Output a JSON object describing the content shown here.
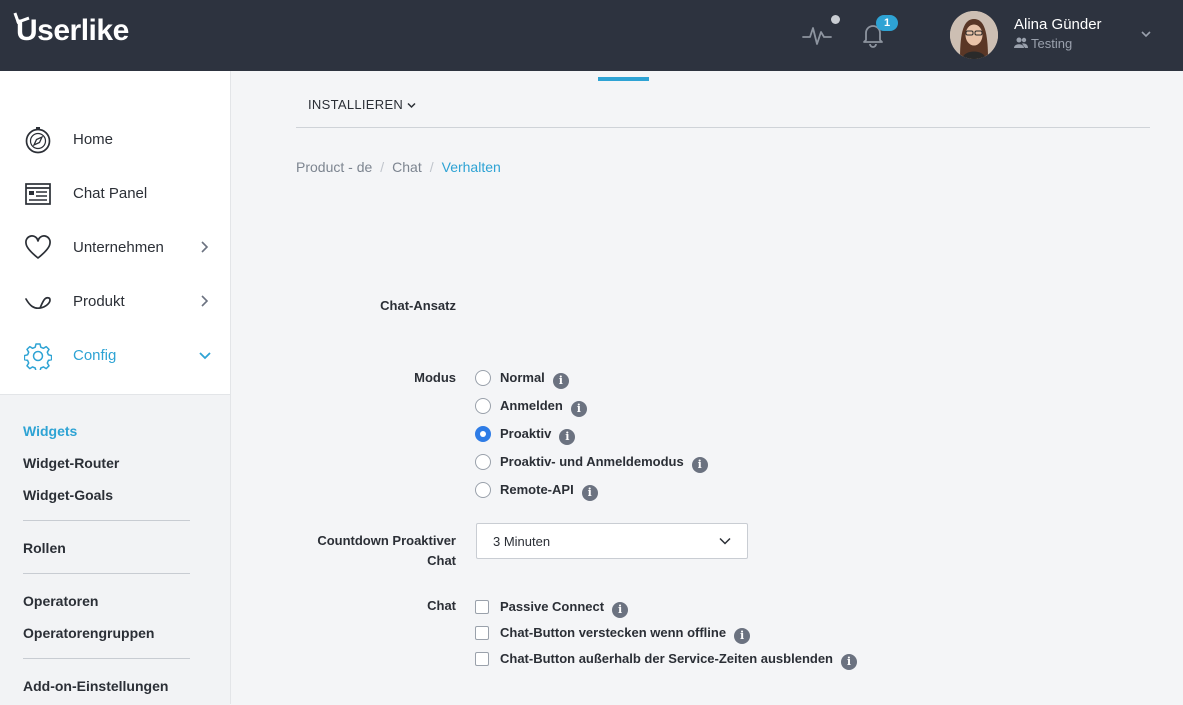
{
  "header": {
    "logo_text": "Userlike",
    "notification_count": "1",
    "user": {
      "name": "Alina Günder",
      "team": "Testing"
    }
  },
  "sidebar": {
    "items": [
      {
        "label": "Home",
        "icon": "compass-icon"
      },
      {
        "label": "Chat Panel",
        "icon": "chat-panel-icon"
      },
      {
        "label": "Unternehmen",
        "icon": "heart-icon"
      },
      {
        "label": "Produkt",
        "icon": "product-icon"
      },
      {
        "label": "Config",
        "icon": "gear-icon"
      }
    ],
    "sub_items": [
      "Widgets",
      "Widget-Router",
      "Widget-Goals",
      "Rollen",
      "Operatoren",
      "Operatorengruppen",
      "Add-on-Einstellungen"
    ]
  },
  "main": {
    "install_tab": "INSTALLIEREN",
    "breadcrumb": [
      "Product - de",
      "Chat",
      "Verhalten"
    ],
    "section_label": "Chat-Ansatz",
    "modus": {
      "label": "Modus",
      "options": [
        "Normal",
        "Anmelden",
        "Proaktiv",
        "Proaktiv- und Anmeldemodus",
        "Remote-API"
      ],
      "selected": "Proaktiv"
    },
    "countdown": {
      "label_line1": "Countdown Proaktiver",
      "label_line2": "Chat",
      "value": "3 Minuten"
    },
    "chat": {
      "label": "Chat",
      "options": [
        "Passive Connect",
        "Chat-Button verstecken wenn offline",
        "Chat-Button außerhalb der Service-Zeiten ausblenden"
      ]
    },
    "info_glyph": "i"
  },
  "colors": {
    "topbar": "#2d333f",
    "accent": "#2ea3d4",
    "radio_selected": "#2e7ce6"
  }
}
